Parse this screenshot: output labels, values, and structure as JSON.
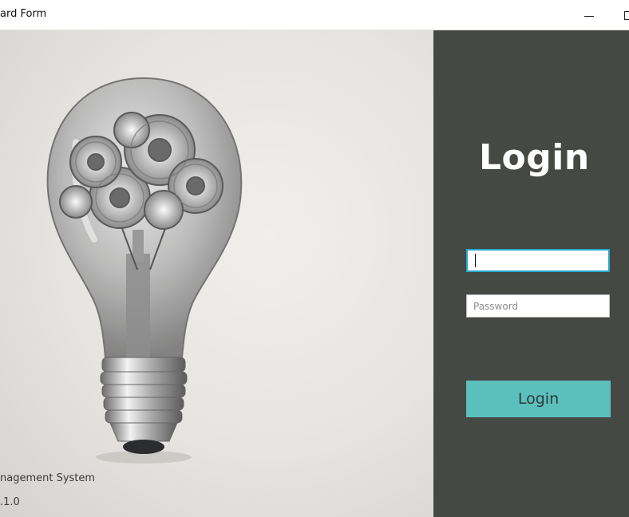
{
  "window": {
    "title": "ard Form",
    "minimize_icon": "minimize-icon",
    "maximize_icon": "maximize-icon"
  },
  "left_panel": {
    "image": "light-bulb-with-gears",
    "system_text": "nagement System",
    "version_text": ".1.0"
  },
  "login": {
    "title": "Login",
    "username": {
      "value": "",
      "placeholder": ""
    },
    "password": {
      "value": "",
      "placeholder": "Password"
    },
    "button_label": "Login"
  },
  "colors": {
    "panel_bg": "#454843",
    "button_bg": "#5bbfbb",
    "focus_border": "#27a8cf"
  }
}
